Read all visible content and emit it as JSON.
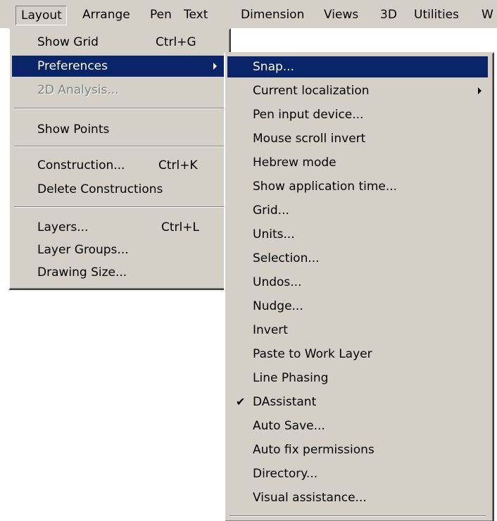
{
  "menubar": {
    "items": [
      "Layout",
      "Arrange",
      "Pen",
      "Text",
      "Dimension",
      "Views",
      "3D",
      "Utilities",
      "W"
    ]
  },
  "layout_menu": {
    "items": [
      {
        "label": "Show Grid",
        "shortcut": "Ctrl+G"
      },
      {
        "label": "Preferences",
        "shortcut": ""
      },
      {
        "label": "2D Analysis...",
        "shortcut": ""
      },
      {
        "label": "Show Points",
        "shortcut": ""
      },
      {
        "label": "Construction...",
        "shortcut": "Ctrl+K"
      },
      {
        "label": "Delete Constructions",
        "shortcut": ""
      },
      {
        "label": "Layers...",
        "shortcut": "Ctrl+L"
      },
      {
        "label": "Layer Groups...",
        "shortcut": ""
      },
      {
        "label": "Drawing Size...",
        "shortcut": ""
      }
    ]
  },
  "preferences_menu": {
    "items": [
      "Snap...",
      "Current localization",
      "Pen input device...",
      "Mouse scroll invert",
      "Hebrew mode",
      "Show application time...",
      "Grid...",
      "Units...",
      "Selection...",
      "Undos...",
      "Nudge...",
      "Invert",
      "Paste to Work Layer",
      "Line Phasing",
      "DAssistant",
      "Auto Save...",
      "Auto fix permissions",
      "Directory...",
      "Visual assistance..."
    ],
    "checked_item": "DAssistant"
  },
  "colors": {
    "menu_bg": "#d4d0c8",
    "highlight": "#0a246a",
    "disabled": "#808080"
  }
}
